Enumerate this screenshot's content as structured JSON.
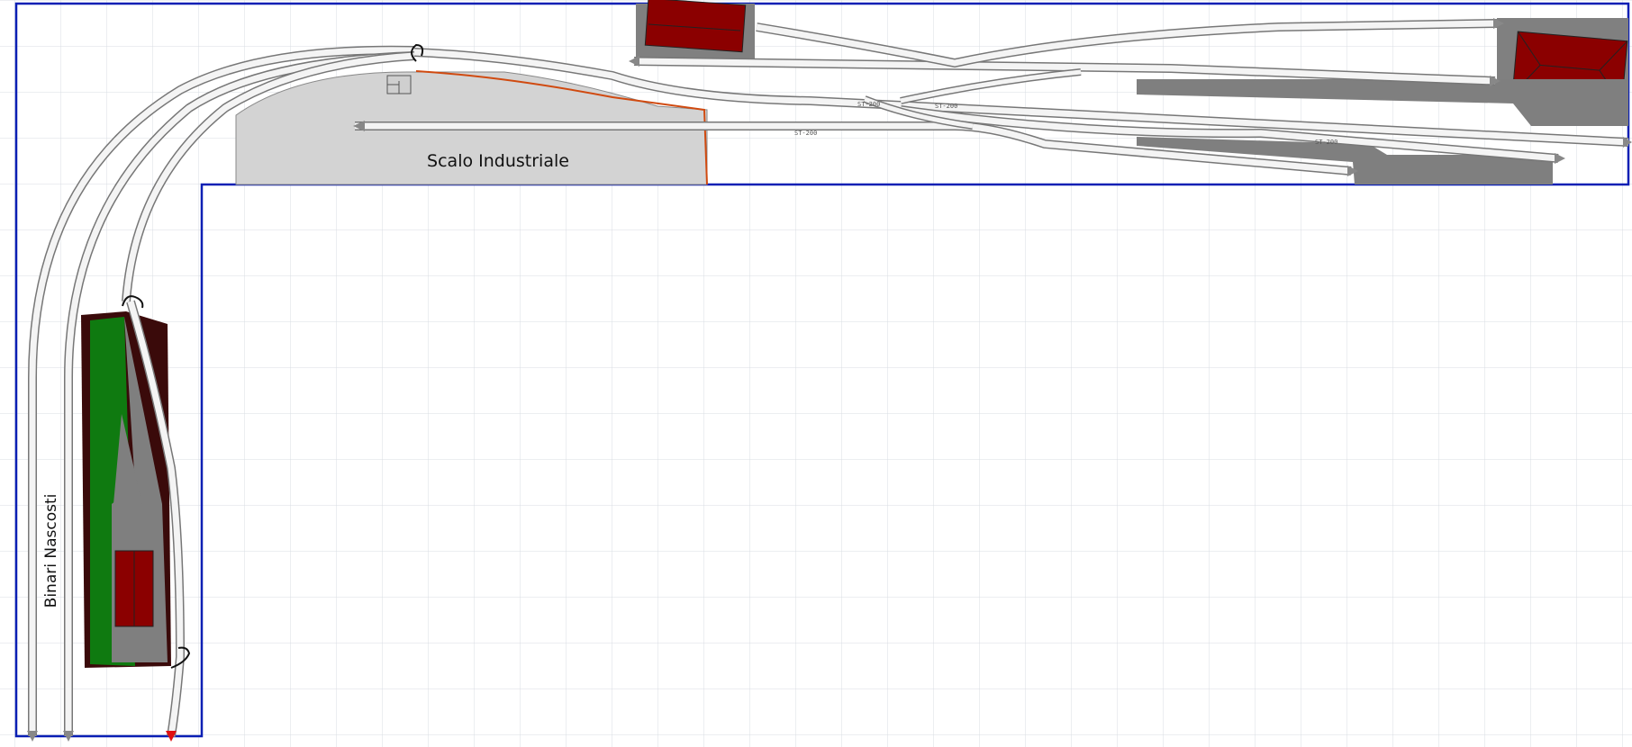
{
  "labels": {
    "industrial_yard": "Scalo Industriale",
    "hidden_tracks": "Binari Nascosti"
  },
  "track_codes": [
    "ST-200",
    "ST-200",
    "ST-200",
    "ST-200"
  ],
  "colors": {
    "background": "#ffffff",
    "grid": "#d9dde3",
    "board_border": "#0a1fb4",
    "track_fill": "#f4f4f4",
    "track_outline": "#777777",
    "yard_fill": "#d3d3d3",
    "platform_dark": "#7f7f7f",
    "building_red": "#8b0000",
    "grass_green": "#0f7a10",
    "base_dark": "#3a0a0a",
    "orange_edge": "#d04a10",
    "end_marker_red": "#e01010"
  },
  "icons": {
    "track_end_marker": "arrow-head",
    "track_end_marker_red": "red-arrow-head",
    "turnaround_loop": "loop-arc-icon"
  }
}
